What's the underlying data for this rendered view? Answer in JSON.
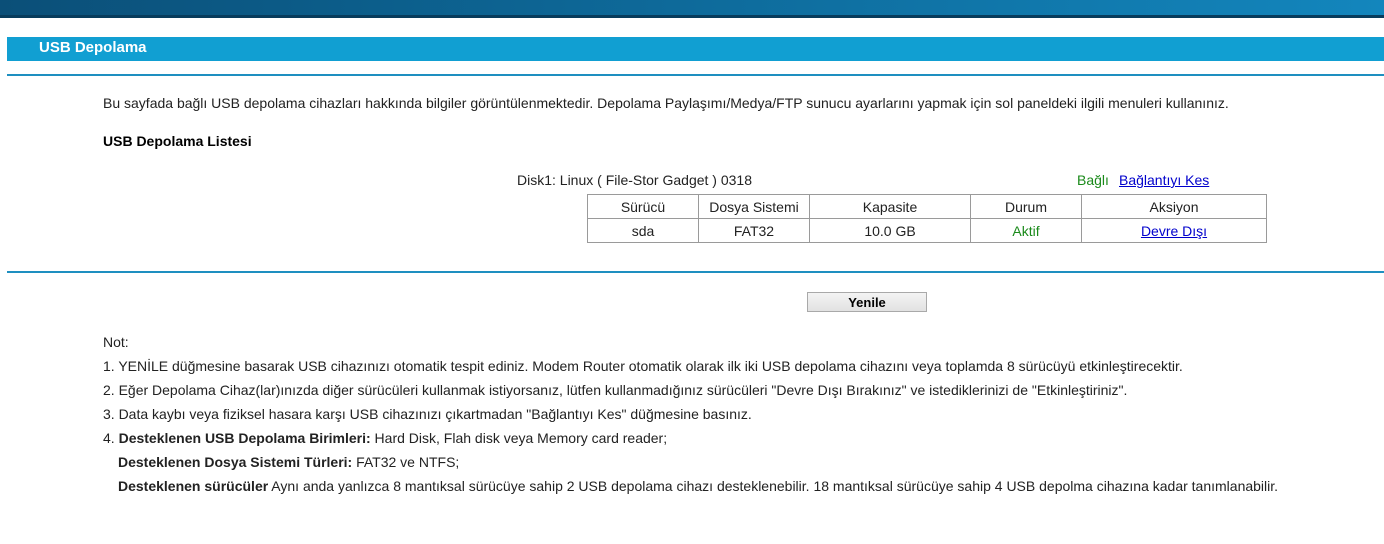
{
  "page": {
    "title": "USB Depolama",
    "intro": "Bu sayfada bağlı USB depolama cihazları hakkında bilgiler görüntülenmektedir. Depolama Paylaşımı/Medya/FTP sunucu ayarlarını yapmak için sol paneldeki ilgili menuleri kullanınız.",
    "list_title": "USB Depolama Listesi"
  },
  "disk": {
    "label": "Disk1: Linux ( File-Stor Gadget ) 0318",
    "status": "Bağlı",
    "disconnect_label": "Bağlantıyı Kes",
    "columns": [
      "Sürücü",
      "Dosya Sistemi",
      "Kapasite",
      "Durum",
      "Aksiyon"
    ],
    "rows": [
      {
        "driver": "sda",
        "filesystem": "FAT32",
        "capacity": "10.0 GB",
        "status": "Aktif",
        "action": "Devre Dışı"
      }
    ]
  },
  "refresh_label": "Yenile",
  "notes": {
    "heading": "Not:",
    "n1": "1. YENİLE düğmesine basarak USB cihazınızı otomatik tespit ediniz. Modem Router otomatik olarak ilk iki USB depolama cihazını veya toplamda 8 sürücüyü etkinleştirecektir.",
    "n2": "2. Eğer Depolama Cihaz(lar)ınızda diğer sürücüleri kullanmak istiyorsanız, lütfen kullanmadığınız sürücüleri \"Devre Dışı Bırakınız\" ve istediklerinizi de \"Etkinleştiriniz\".",
    "n3": "3. Data kaybı veya fiziksel hasara karşı USB cihazınızı çıkartmadan \"Bağlantıyı Kes\" düğmesine basınız.",
    "n4_prefix": "4. ",
    "n4_bold": "Desteklenen USB Depolama Birimleri:",
    "n4_text": " Hard Disk, Flah disk veya Memory card reader;",
    "n5_bold": "Desteklenen Dosya Sistemi Türleri:",
    "n5_text": " FAT32 ve NTFS;",
    "n6_bold": "Desteklenen sürücüler",
    "n6_text": " Aynı anda yanlızca 8 mantıksal sürücüye sahip 2 USB depolama cihazı desteklenebilir. 18 mantıksal sürücüye sahip 4 USB depolma cihazına kadar tanımlanabilir."
  },
  "colors": {
    "title_bar": "#119fd2",
    "divider": "#1e8fc0",
    "status_green": "#1a8a1a",
    "link_blue": "#0000cc"
  }
}
